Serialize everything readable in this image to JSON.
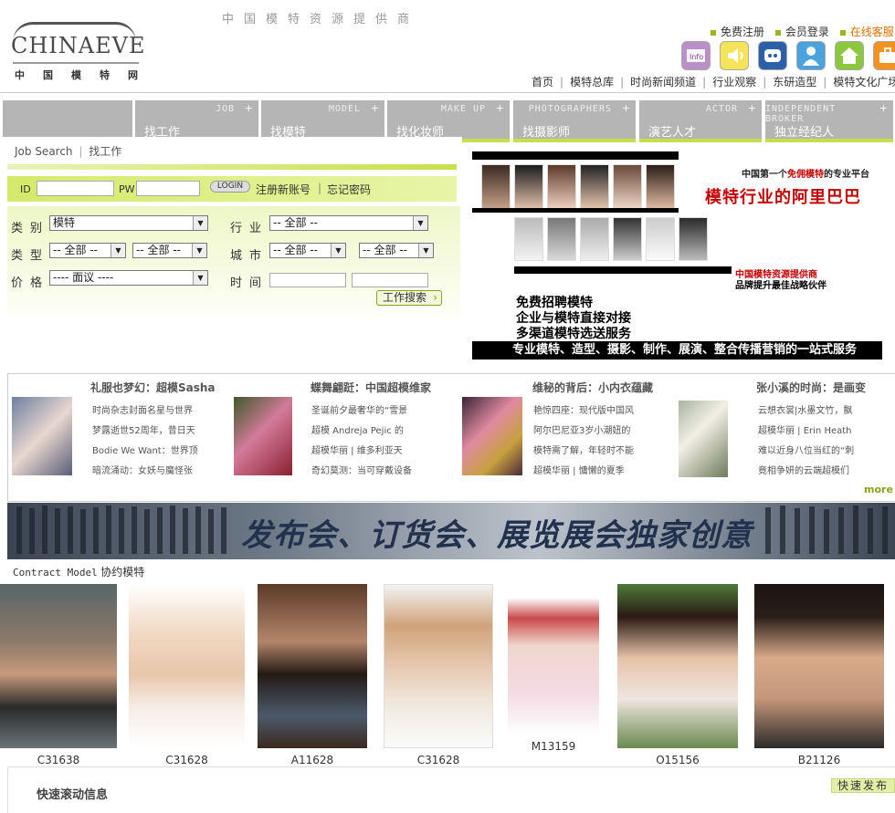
{
  "logo": {
    "word": "CHINAEVE",
    "cn": "中国模特网"
  },
  "tagline": "中国模特资源提供商",
  "top_links": {
    "register": "免费注册",
    "login": "会员登录",
    "service": "在线客服"
  },
  "icons": [
    "info-icon",
    "speaker-icon",
    "chat-icon",
    "user-icon",
    "home-icon",
    "briefcase-icon"
  ],
  "main_nav": [
    "首页",
    "模特总库",
    "时尚新闻频道",
    "行业观察",
    "东研造型",
    "模特文化广场"
  ],
  "tabs": [
    {
      "en": "",
      "cn": ""
    },
    {
      "en": "JOB",
      "cn": "找工作"
    },
    {
      "en": "MODEL",
      "cn": "找模特"
    },
    {
      "en": "MAKE UP",
      "cn": "找化妆师"
    },
    {
      "en": "PHOTOGRAPHERS",
      "cn": "找摄影师"
    },
    {
      "en": "ACTOR",
      "cn": "演艺人才"
    },
    {
      "en": "INDEPENDENT BROKER",
      "cn": "独立经纪人"
    }
  ],
  "job_search": {
    "en": "Job Search",
    "sep": "|",
    "cn": "找工作"
  },
  "login": {
    "id_label": "ID",
    "pw_label": "PW",
    "button": "LOGIN",
    "register": "注册新账号",
    "sep": "|",
    "forgot": "忘记密码"
  },
  "form": {
    "category_label": "类别",
    "category_value": "模特",
    "industry_label": "行业",
    "industry_value": "-- 全部 --",
    "type_label": "类型",
    "type_value1": "-- 全部 --",
    "type_value2": "-- 全部 --",
    "city_label": "城市",
    "city_value1": "-- 全部 --",
    "city_value2": "-- 全部 --",
    "price_label": "价格",
    "price_value": "---- 面议 ----",
    "time_label": "时间",
    "search_button": "工作搜索"
  },
  "right_banner": {
    "line1_a": "中国第一个",
    "line1_b": "免佣模特",
    "line1_c": "的专业平台",
    "line2": "模特行业的阿里巴巴",
    "line3": "中国模特资源提供商",
    "line4": "品牌提升最佳战略伙伴",
    "line5": "免费招聘模特",
    "line6": "企业与模特直接对接",
    "line7": "多渠道模特选送服务",
    "bar": "专业模特、造型、摄影、制作、展演、整合传播营销的一站式服务"
  },
  "news": [
    {
      "title": "礼服也梦幻：超模Sasha",
      "lines": [
        "时尚杂志封面名星与世界",
        "梦露逝世52周年，昔日天",
        "Bodie We Want：世界顶",
        "暗流涌动：女妖与魔怪张"
      ]
    },
    {
      "title": "蝶舞翩跹：中国超模维家",
      "lines": [
        "圣诞前夕最奢华的“雪景",
        "超模 Andreja Pejic 的",
        "超模华丽 | 维多利亚天",
        "奇幻莫测：当可穿戴设备"
      ]
    },
    {
      "title": "维秘的背后：小内衣蕴藏",
      "lines": [
        "艳惊四座：现代版中国风",
        "阿尔巴尼亚3岁小潮妞的",
        "模特需了解，年轻时不能",
        "超模华丽 | 慵懒的夏季"
      ]
    },
    {
      "title": "张小溪的时尚：是画变",
      "lines": [
        "云想衣裳|水墨文竹，飘",
        "超模华丽 | Erin Heath",
        "难以近身八位当红的“刺",
        "竟相争妍的云端超模们"
      ]
    }
  ],
  "more": "more",
  "ad_banner": "发布会、订货会、展览展会独家创意",
  "contract": {
    "en": "Contract Model",
    "cn": "协约模特"
  },
  "models": [
    "C31638",
    "C31628",
    "A11628",
    "C31628",
    "M13159",
    "O15156",
    "B21126"
  ],
  "scroll_title": "快速滚动信息",
  "quick_publish": "快速发布",
  "colors": {
    "accent": "#c6e04a",
    "tab_gray": "#b5b5b5",
    "red": "#c40000"
  }
}
